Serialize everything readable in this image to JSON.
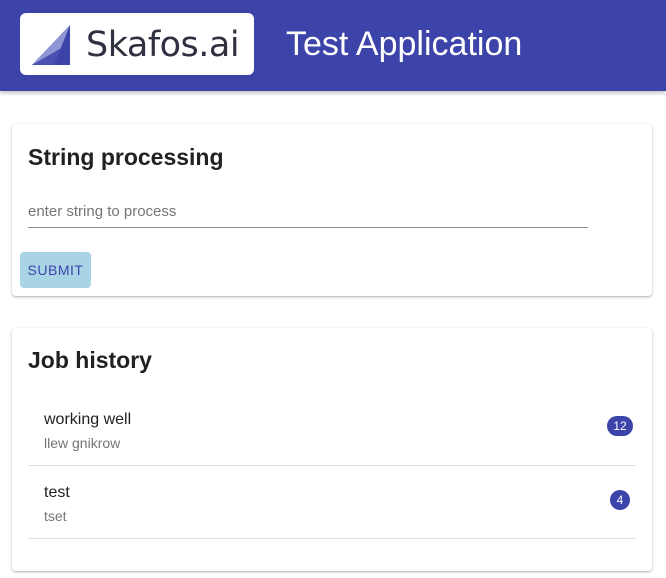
{
  "header": {
    "logo_text": "Skafos.ai",
    "app_title": "Test Application",
    "colors": {
      "appbar": "#3c44aa",
      "logo_mark_light": "#8f96d6",
      "logo_mark_dark": "#3c44aa"
    }
  },
  "string_processing": {
    "title": "String processing",
    "input_placeholder": "enter string to process",
    "input_value": "",
    "submit_label": "SUBMIT"
  },
  "job_history": {
    "title": "Job history",
    "items": [
      {
        "primary": "working well",
        "secondary": "llew gnikrow",
        "badge": "12"
      },
      {
        "primary": "test",
        "secondary": "tset",
        "badge": "4"
      }
    ]
  }
}
